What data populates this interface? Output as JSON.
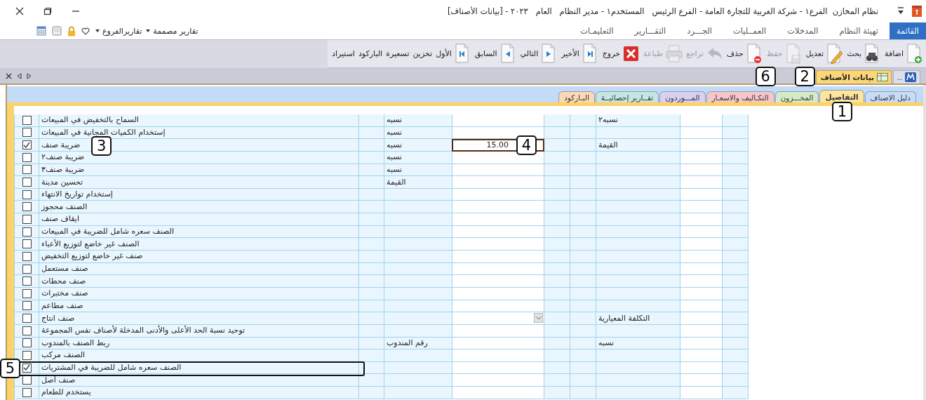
{
  "window": {
    "title": "نظام المخازن  الفرع١ - شركة الغربية للتجارة العامة - الفرع الرئيس   المستخدم١ - مدير النظام   العام   ٢٠٢٣ - [بيانات الأصناف]"
  },
  "quick_links": [
    {
      "label": "تقارير مصممة"
    },
    {
      "label": "تقاريرالفروع"
    }
  ],
  "menu": [
    {
      "label": "القائمة",
      "selected": true
    },
    {
      "label": "تهيئة النظام",
      "selected": false
    },
    {
      "label": "المدخلات",
      "selected": false
    },
    {
      "label": "العمــليات",
      "selected": false
    },
    {
      "label": "الجـــرد",
      "selected": false
    },
    {
      "label": "التقـــارير",
      "selected": false
    },
    {
      "label": "التعليمـات",
      "selected": false
    }
  ],
  "toolbar": [
    {
      "kind": "add",
      "label": "اضافة",
      "disabled": false
    },
    {
      "kind": "search",
      "label": "بحث",
      "disabled": false
    },
    {
      "kind": "edit",
      "label": "تعديل",
      "disabled": false,
      "callout": "2"
    },
    {
      "kind": "save",
      "label": "حفظ",
      "disabled": true,
      "callout": "6"
    },
    {
      "kind": "delete",
      "label": "حذف",
      "disabled": false
    },
    {
      "kind": "undo",
      "label": "تراجع",
      "disabled": true
    },
    {
      "kind": "print",
      "label": "طباعة",
      "disabled": true
    },
    {
      "kind": "exit",
      "label": "خروج",
      "disabled": false
    },
    {
      "kind": "last",
      "label": "الأخير",
      "disabled": false
    },
    {
      "kind": "next",
      "label": "التالي",
      "disabled": false
    },
    {
      "kind": "prev",
      "label": "السابق",
      "disabled": false
    },
    {
      "kind": "first",
      "label": "الأول",
      "disabled": false
    },
    {
      "kind": "text",
      "label": "تخزين",
      "disabled": false
    },
    {
      "kind": "text",
      "label": "تسعيرة",
      "disabled": false
    },
    {
      "kind": "text",
      "label": "الباركود",
      "disabled": false
    },
    {
      "kind": "text",
      "label": "استيراد",
      "disabled": false
    }
  ],
  "document_tabs": [
    {
      "label": "..",
      "selected": false
    },
    {
      "label": "بيانات الأصناف",
      "selected": true
    }
  ],
  "section_tabs": [
    {
      "label": "دليل الاصناف",
      "selected": false,
      "color": "#c9dcf7"
    },
    {
      "label": "التفاصيل",
      "selected": true,
      "color": "#fde59a",
      "callout": "1"
    },
    {
      "label": "المخـــزون",
      "selected": false,
      "color": "#d5ebc6"
    },
    {
      "label": "التكـاليف والاسعـار",
      "selected": false,
      "color": "#f7c6c8"
    },
    {
      "label": "المـــوردون",
      "selected": false,
      "color": "#d9d0f2"
    },
    {
      "label": "تقــارير إحصائيــة",
      "selected": false,
      "color": "#c6e7df"
    },
    {
      "label": "البـاركود",
      "selected": false,
      "color": "#fcd9b4"
    }
  ],
  "table": {
    "rows": [
      {
        "checked": false,
        "label": "السماح بالتخفيض في المبيعات",
        "type": "نسبه",
        "type_2": "نسبه٢"
      },
      {
        "checked": false,
        "label": "إستخدام الكميات المجانية في المبيعات",
        "type": "نسبه"
      },
      {
        "checked": true,
        "label": "ضريبة صنف",
        "type": "نسبه",
        "value": "15.00",
        "type_2": "القيمة",
        "label_callout": "3",
        "value_callout": "4"
      },
      {
        "checked": false,
        "label": "ضريبة صنف٢",
        "type": "نسبه"
      },
      {
        "checked": false,
        "label": "ضريبة صنف٣",
        "type": "نسبه"
      },
      {
        "checked": false,
        "label": "تحسين مدينة",
        "type": "القيمة"
      },
      {
        "checked": false,
        "label": "إستخدام تواريخ الانتهاء"
      },
      {
        "checked": false,
        "label": "الصنف محجوز"
      },
      {
        "checked": false,
        "label": "ايقاف صنف"
      },
      {
        "checked": false,
        "label": "الصنف سعره شامل للضريبة في المبيعات"
      },
      {
        "checked": false,
        "label": "الصنف غير خاضع لتوزيع الأعباء"
      },
      {
        "checked": false,
        "label": "صنف غير خاضع لتوزيع التخفيض"
      },
      {
        "checked": false,
        "label": "صنف مستعمل"
      },
      {
        "checked": false,
        "label": "صنف محطات"
      },
      {
        "checked": false,
        "label": "صنف مختبرات"
      },
      {
        "checked": false,
        "label": "صنف مطاعم"
      },
      {
        "checked": false,
        "label": "صنف انتاج",
        "dropdown": true,
        "type_2": "التكلفة المعيارية"
      },
      {
        "checked": false,
        "label": "توحيد نسبة الحد الأعلى والأدنى المدخلة لأصناف نفس المجموعة"
      },
      {
        "checked": false,
        "label": "ربط الصنف بالمندوب",
        "type": "رقم المندوب",
        "type_2": "نسبه"
      },
      {
        "checked": false,
        "label": "الصنف مركب"
      },
      {
        "checked": true,
        "label": "الصنف سعره شامل للضريبة في المشتريات",
        "row_callout": "5"
      },
      {
        "checked": false,
        "label": "صنف أصل"
      },
      {
        "checked": false,
        "label": "يستخدم للطعام"
      }
    ]
  }
}
